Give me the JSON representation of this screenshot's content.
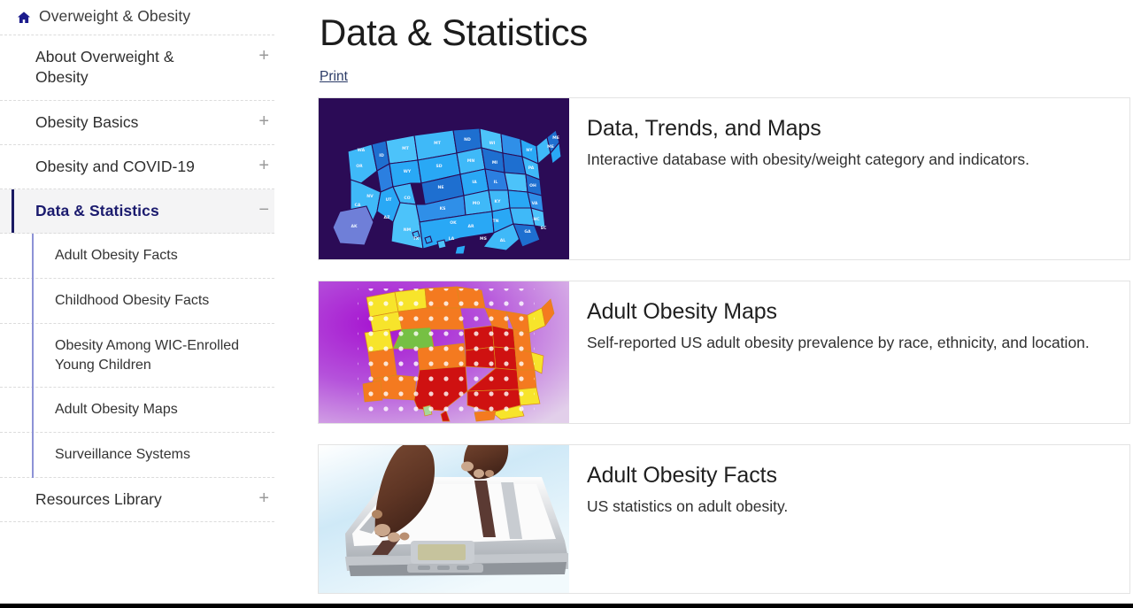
{
  "sidebar": {
    "home": {
      "label": "Overweight & Obesity",
      "icon": "home-icon"
    },
    "items": [
      {
        "label": "About Overweight & Obesity",
        "toggle": "+",
        "active": false
      },
      {
        "label": "Obesity Basics",
        "toggle": "+",
        "active": false
      },
      {
        "label": "Obesity and COVID-19",
        "toggle": "+",
        "active": false
      },
      {
        "label": "Data & Statistics",
        "toggle": "−",
        "active": true
      },
      {
        "label": "Resources Library",
        "toggle": "+",
        "active": false
      }
    ],
    "subitems": [
      {
        "label": "Adult Obesity Facts"
      },
      {
        "label": "Childhood Obesity Facts"
      },
      {
        "label": "Obesity Among WIC-Enrolled Young Children"
      },
      {
        "label": "Adult Obesity Maps"
      },
      {
        "label": "Surveillance Systems"
      }
    ]
  },
  "main": {
    "title": "Data & Statistics",
    "print_label": "Print",
    "cards": [
      {
        "title": "Data, Trends, and Maps",
        "desc": "Interactive database with obesity/weight category and indicators.",
        "thumb": "us-map-blue-states-image"
      },
      {
        "title": "Adult Obesity Maps",
        "desc": "Self-reported US adult obesity prevalence by race, ethnicity, and location.",
        "thumb": "us-map-heat-prevalence-image"
      },
      {
        "title": "Adult Obesity Facts",
        "desc": "US statistics on adult obesity.",
        "thumb": "feet-on-bathroom-scale-photo"
      }
    ]
  },
  "colors": {
    "active_nav": "#1b1b6e",
    "accent_rule": "#8d92d6",
    "link": "#2a3a66",
    "map_bg": "#2b0b56"
  }
}
